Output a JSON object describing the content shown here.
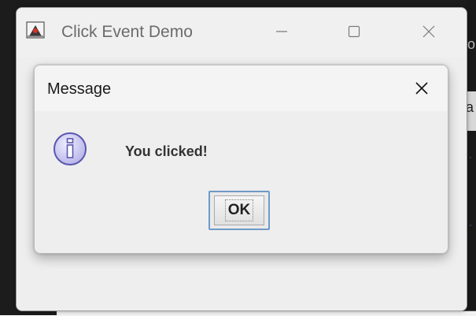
{
  "main_window": {
    "title": "Click Event Demo",
    "icons": {
      "app": "java-duke-icon",
      "minimize": "minimize-icon",
      "maximize": "maximize-icon",
      "close": "close-icon"
    }
  },
  "dialog": {
    "title": "Message",
    "message": "You clicked!",
    "ok_label": "OK",
    "icons": {
      "info": "info-icon",
      "close": "close-icon"
    }
  },
  "background": {
    "right_glyph_top": "o",
    "right_glyph_mid": "a"
  },
  "colors": {
    "window_bg": "#eeeeee",
    "titlebar_bg": "#f0f0f0",
    "ok_focus_border": "#6f9ac6",
    "info_icon_fill": "#c9c7ee",
    "info_icon_stroke": "#5a57b0"
  }
}
